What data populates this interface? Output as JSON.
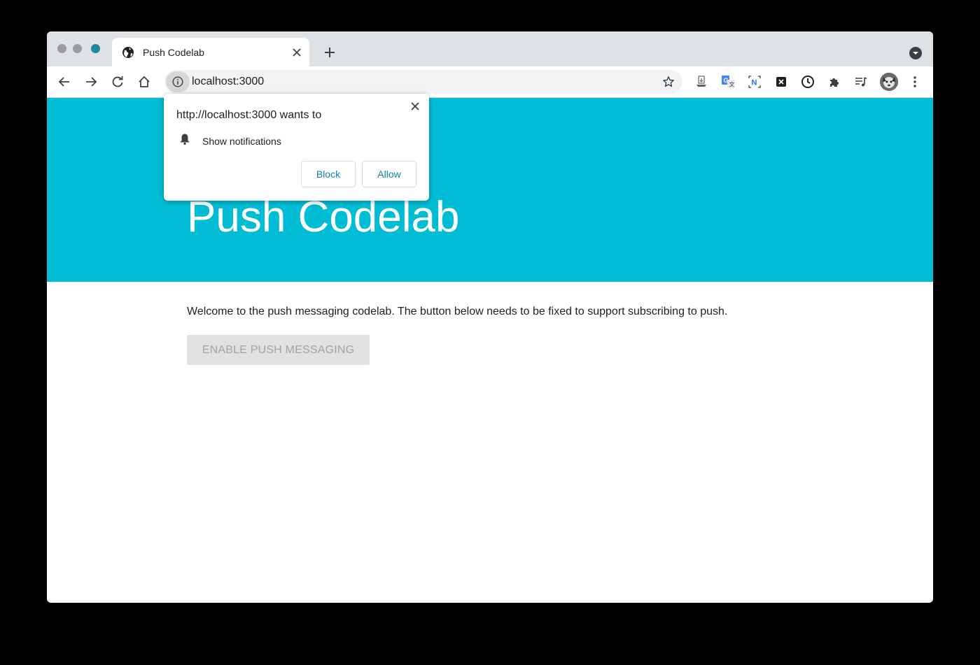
{
  "browser": {
    "tab": {
      "title": "Push Codelab"
    },
    "address_bar": {
      "url": "localhost:3000"
    }
  },
  "permission_prompt": {
    "title": "http://localhost:3000 wants to",
    "permission": "Show notifications",
    "block_label": "Block",
    "allow_label": "Allow"
  },
  "page": {
    "heading": "Push Codelab",
    "welcome_text": "Welcome to the push messaging codelab. The button below needs to be fixed to support subscribing to push.",
    "push_button_label": "ENABLE PUSH MESSAGING"
  },
  "colors": {
    "banner": "#00bcd4",
    "prompt_button_text": "#127fa3",
    "disabled_button_bg": "#dfe1e3"
  },
  "icons": {
    "tab": "globe-icon",
    "toolbar": [
      "back-arrow-icon",
      "forward-arrow-icon",
      "reload-icon",
      "home-icon",
      "site-info-icon",
      "bookmark-star-icon"
    ],
    "extensions": [
      "download-extension-icon",
      "translate-extension-icon",
      "notion-extension-icon",
      "x-extension-icon",
      "clock-extension-icon",
      "puzzle-extensions-icon",
      "media-queue-icon",
      "kebab-menu-icon"
    ],
    "prompt": "bell-icon"
  }
}
